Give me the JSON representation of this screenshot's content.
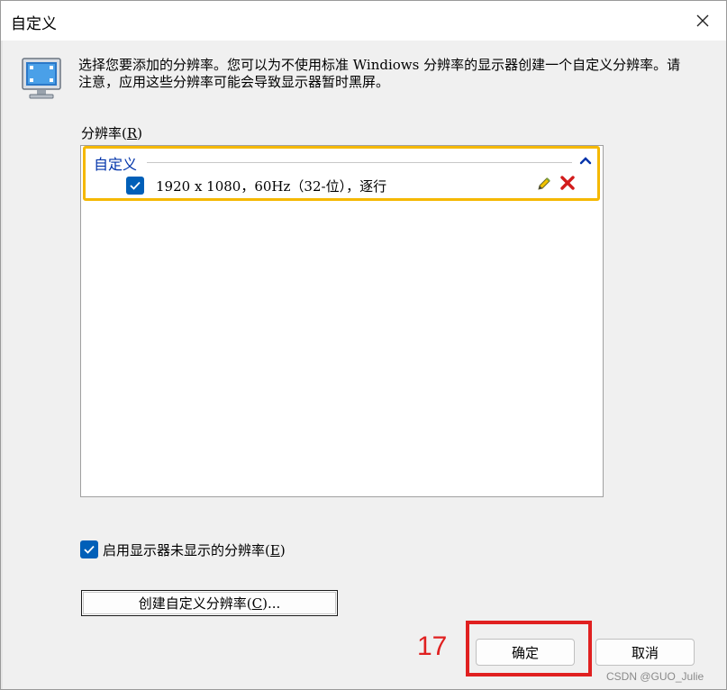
{
  "window": {
    "title": "自定义"
  },
  "description": "选择您要添加的分辨率。您可以为不使用标准 Windiows 分辨率的显示器创建一个自定义分辨率。请注意，应用这些分辨率可能会导致显示器暂时黑屏。",
  "resolution_list": {
    "label_prefix": "分辨率(",
    "label_key": "R",
    "label_suffix": ")",
    "group": {
      "title": "自定义",
      "items": [
        {
          "text": "1920 x 1080，60Hz（32-位），逐行",
          "checked": true
        }
      ]
    }
  },
  "enable_option": {
    "label_prefix": "启用显示器未显示的分辨率(",
    "label_key": "E",
    "label_suffix": ")",
    "checked": true
  },
  "create_button": {
    "label_prefix": "创建自定义分辨率(",
    "label_key": "C",
    "label_suffix": ")..."
  },
  "annotation": {
    "step_number": "17",
    "color": "#e02020"
  },
  "buttons": {
    "ok": "确定",
    "cancel": "取消"
  },
  "watermark": "CSDN @GUO_Julie",
  "colors": {
    "accent": "#005fb8",
    "group_highlight": "#f5b800",
    "group_title": "#0033aa"
  }
}
